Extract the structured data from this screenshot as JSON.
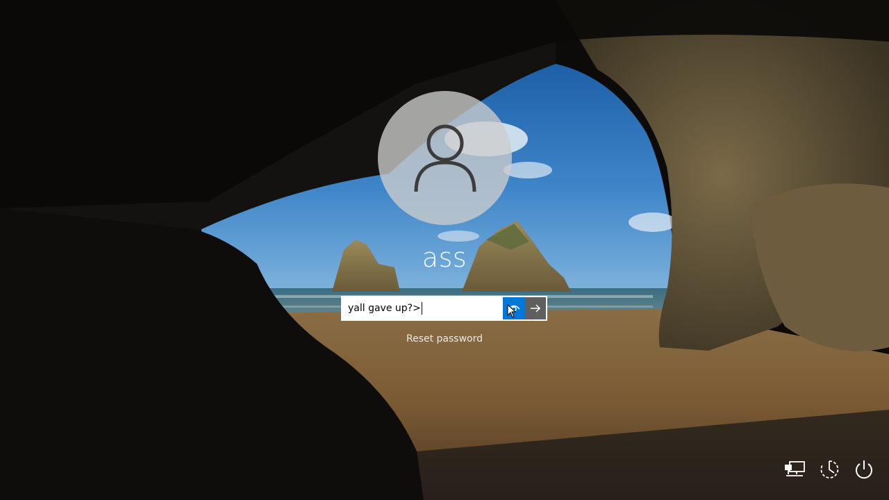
{
  "user": {
    "name": "ass",
    "avatar_icon": "user-icon"
  },
  "password": {
    "value": "yall gave up?>",
    "reveal_icon": "eye-icon",
    "submit_icon": "arrow-right-icon"
  },
  "links": {
    "reset_password": "Reset password"
  },
  "system_icons": [
    "network-icon",
    "ease-of-access-icon",
    "power-icon"
  ],
  "colors": {
    "accent": "#0078d7",
    "submit_bg": "#5f5f5f"
  }
}
